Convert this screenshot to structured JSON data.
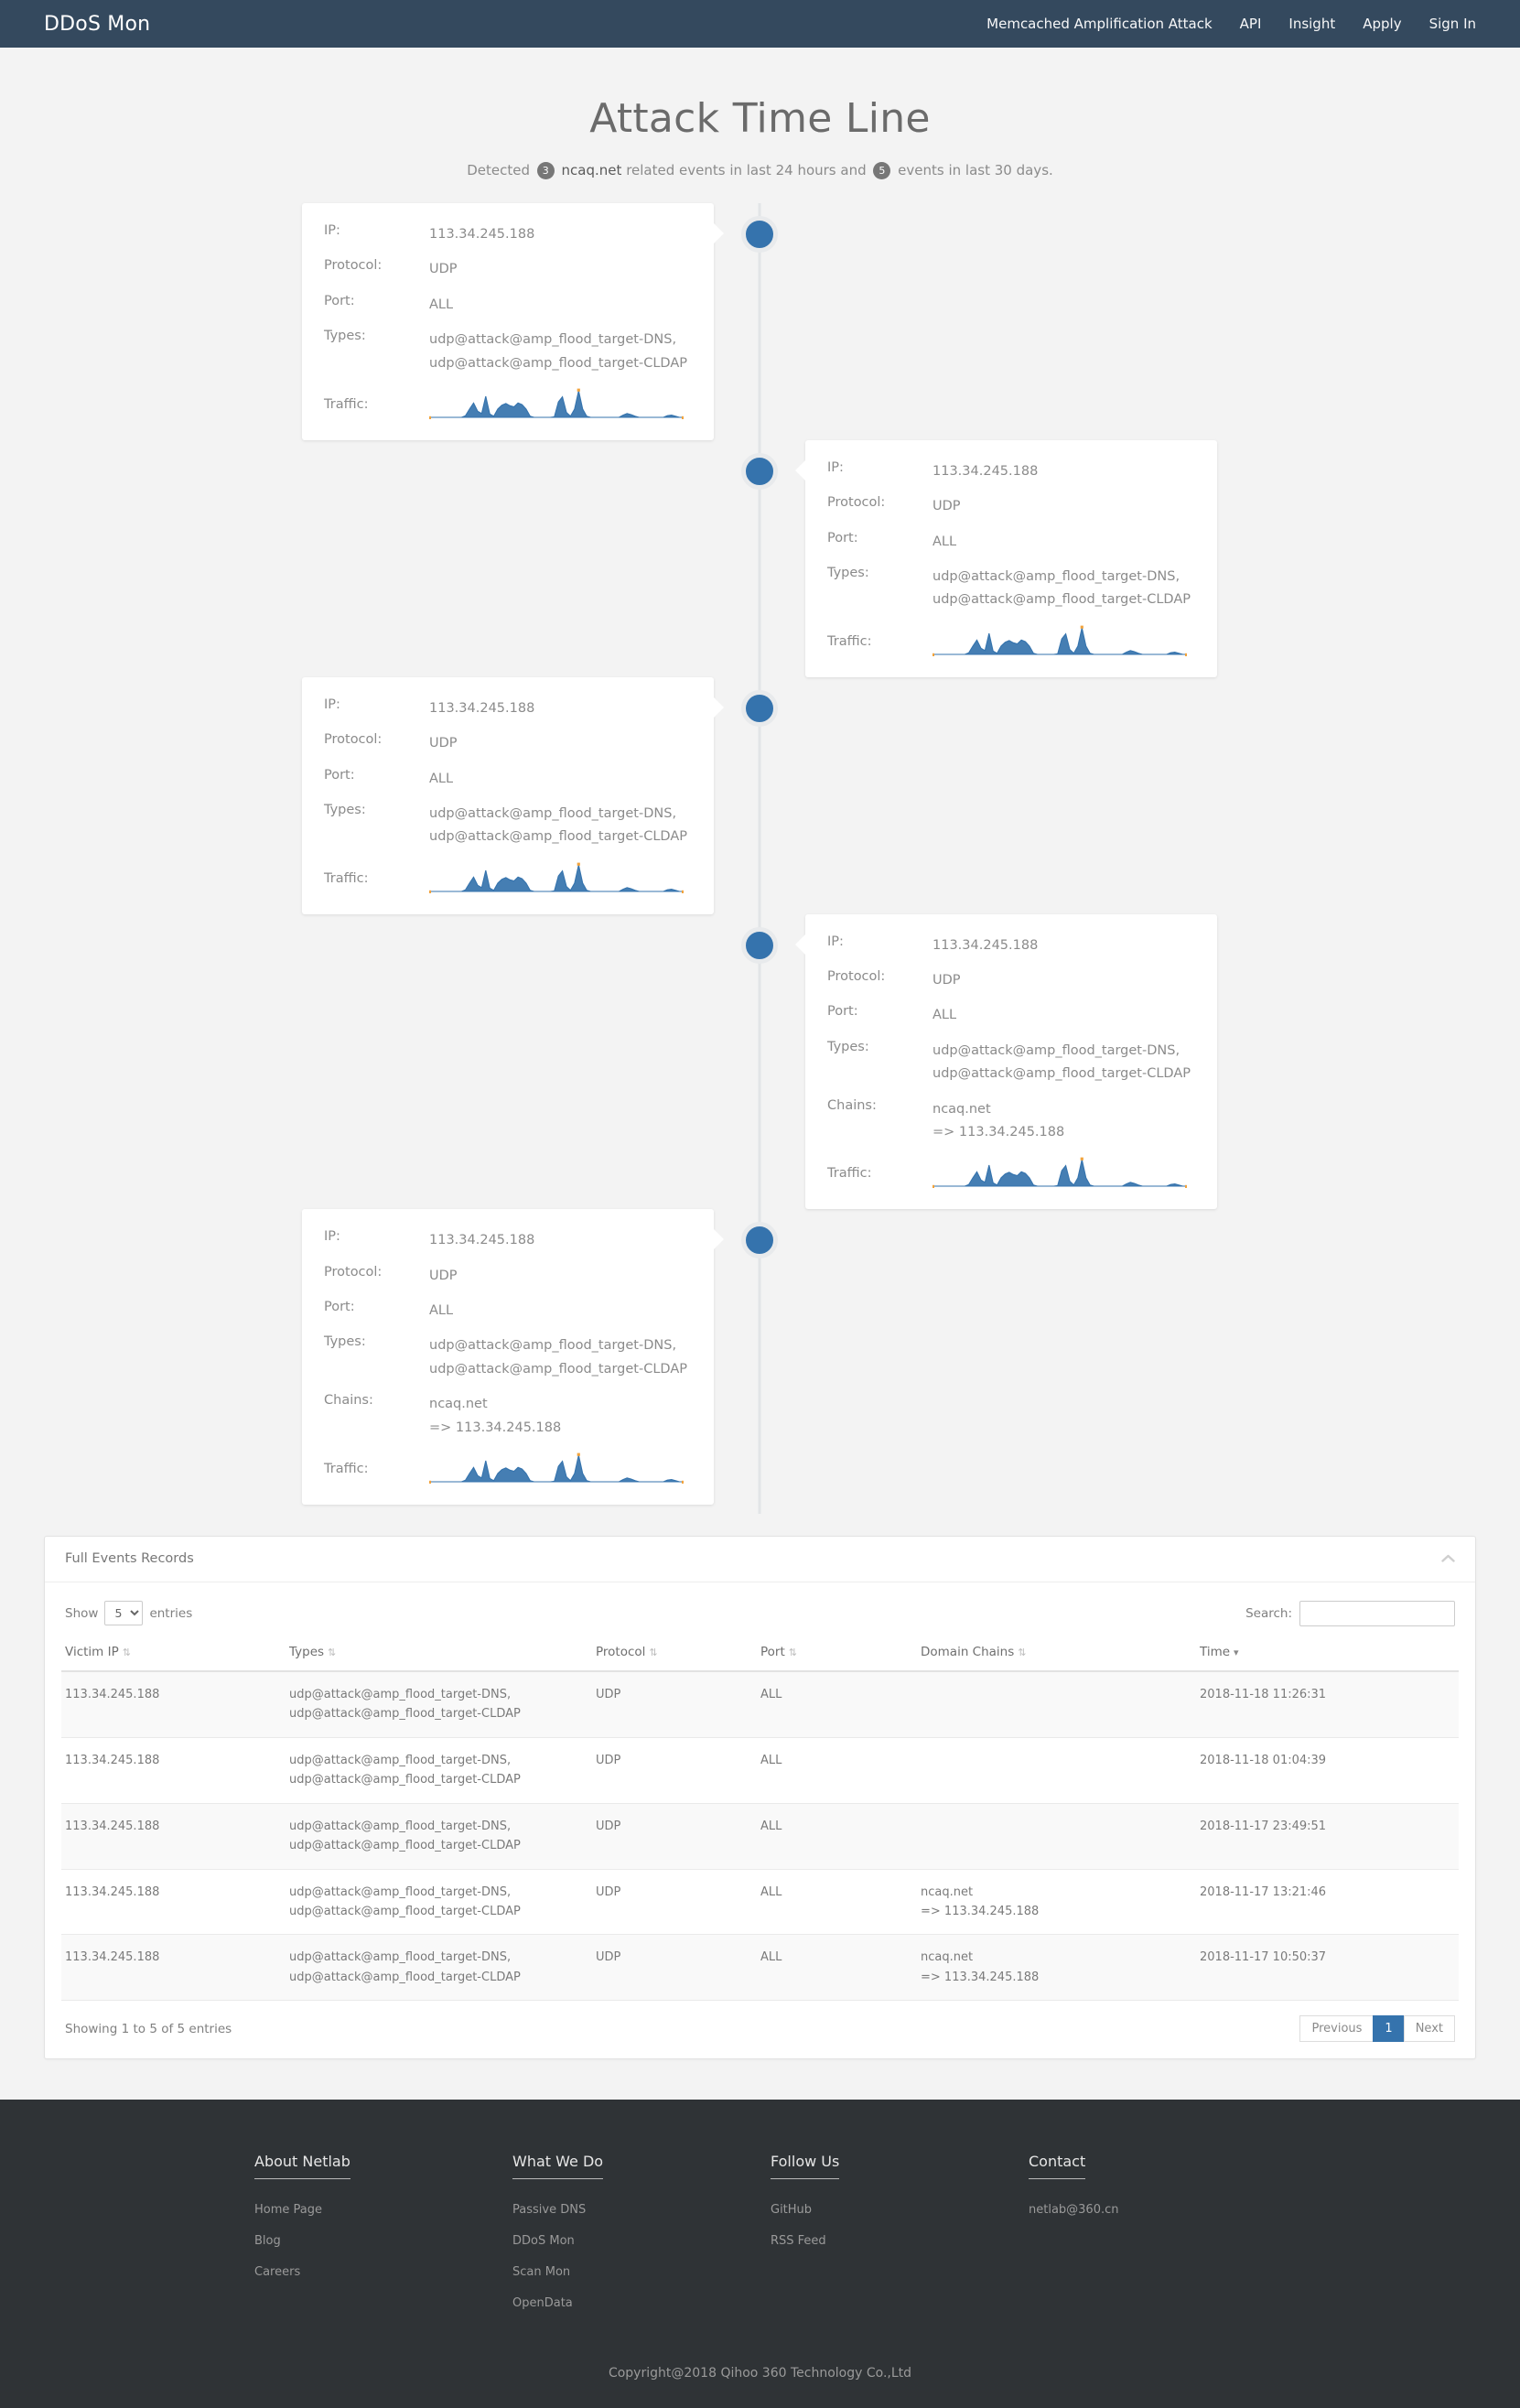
{
  "nav": {
    "brand": "DDoS Mon",
    "links": [
      {
        "label": "Memcached Amplification Attack"
      },
      {
        "label": "API"
      },
      {
        "label": "Insight"
      },
      {
        "label": "Apply"
      },
      {
        "label": "Sign In"
      }
    ]
  },
  "page": {
    "title": "Attack Time Line",
    "subtitle_part1": "Detected",
    "count_24h": "3",
    "domain": "ncaq.net",
    "subtitle_part2": "related events in last 24 hours and",
    "count_30d": "5",
    "subtitle_part3": "events in last 30 days."
  },
  "labels": {
    "ip": "IP:",
    "protocol": "Protocol:",
    "port": "Port:",
    "types": "Types:",
    "chains": "Chains:",
    "traffic": "Traffic:"
  },
  "timeline": {
    "events": [
      {
        "side": "left",
        "date": "2018-11-18",
        "time": "11:26:31",
        "ip": "113.34.245.188",
        "protocol": "UDP",
        "port": "ALL",
        "types_line1": "udp@attack@amp_flood_target-DNS,",
        "types_line2": "udp@attack@amp_flood_target-CLDAP",
        "chains_line1": "",
        "chains_line2": "",
        "has_chains": false
      },
      {
        "side": "right",
        "date": "2018-11-18",
        "time": "01:04:39",
        "ip": "113.34.245.188",
        "protocol": "UDP",
        "port": "ALL",
        "types_line1": "udp@attack@amp_flood_target-DNS,",
        "types_line2": "udp@attack@amp_flood_target-CLDAP",
        "chains_line1": "",
        "chains_line2": "",
        "has_chains": false
      },
      {
        "side": "left",
        "date": "2018-11-17",
        "time": "23:49:51",
        "ip": "113.34.245.188",
        "protocol": "UDP",
        "port": "ALL",
        "types_line1": "udp@attack@amp_flood_target-DNS,",
        "types_line2": "udp@attack@amp_flood_target-CLDAP",
        "chains_line1": "",
        "chains_line2": "",
        "has_chains": false
      },
      {
        "side": "right",
        "date": "2018-11-17",
        "time": "13:21:46",
        "ip": "113.34.245.188",
        "protocol": "UDP",
        "port": "ALL",
        "types_line1": "udp@attack@amp_flood_target-DNS,",
        "types_line2": "udp@attack@amp_flood_target-CLDAP",
        "chains_line1": "ncaq.net",
        "chains_line2": "=> 113.34.245.188",
        "has_chains": true
      },
      {
        "side": "left",
        "date": "2018-11-17",
        "time": "10:50:37",
        "ip": "113.34.245.188",
        "protocol": "UDP",
        "port": "ALL",
        "types_line1": "udp@attack@amp_flood_target-DNS,",
        "types_line2": "udp@attack@amp_flood_target-CLDAP",
        "chains_line1": "ncaq.net",
        "chains_line2": "=> 113.34.245.188",
        "has_chains": true
      }
    ]
  },
  "chart_data": {
    "type": "area",
    "title": "Traffic",
    "xlabel": "",
    "ylabel": "",
    "grid": false,
    "legend": "none",
    "line_color": "#3573ad",
    "fill_color": "#3573ad",
    "marker_color": "#f2a33c",
    "ylim": [
      0,
      100
    ],
    "series": [
      {
        "name": "Traffic sparkline",
        "values": [
          0,
          0,
          0,
          0,
          0,
          0,
          0,
          0,
          0,
          6,
          30,
          52,
          22,
          14,
          76,
          12,
          4,
          30,
          44,
          50,
          42,
          38,
          52,
          46,
          30,
          4,
          0,
          0,
          0,
          0,
          0,
          2,
          56,
          74,
          18,
          4,
          30,
          96,
          30,
          4,
          0,
          0,
          0,
          0,
          0,
          0,
          0,
          0,
          8,
          14,
          10,
          4,
          0,
          0,
          0,
          0,
          0,
          0,
          0,
          6,
          8,
          4,
          0,
          0
        ]
      }
    ]
  },
  "panel": {
    "title": "Full Events Records",
    "collapse_icon": "chevron-up",
    "show_label": "Show",
    "entries_label": "entries",
    "page_length": "5",
    "page_length_options": [
      "5",
      "10",
      "25",
      "50",
      "100"
    ],
    "search_label": "Search:",
    "search_value": "",
    "search_placeholder": "",
    "columns": [
      {
        "label": "Victim IP",
        "sort": "none"
      },
      {
        "label": "Types",
        "sort": "none"
      },
      {
        "label": "Protocol",
        "sort": "none"
      },
      {
        "label": "Port",
        "sort": "none"
      },
      {
        "label": "Domain Chains",
        "sort": "none"
      },
      {
        "label": "Time",
        "sort": "desc"
      }
    ],
    "rows": [
      {
        "victim_ip": "113.34.245.188",
        "types_line1": "udp@attack@amp_flood_target-DNS,",
        "types_line2": "udp@attack@amp_flood_target-CLDAP",
        "protocol": "UDP",
        "port": "ALL",
        "chains_line1": "",
        "chains_line2": "",
        "time": "2018-11-18 11:26:31"
      },
      {
        "victim_ip": "113.34.245.188",
        "types_line1": "udp@attack@amp_flood_target-DNS,",
        "types_line2": "udp@attack@amp_flood_target-CLDAP",
        "protocol": "UDP",
        "port": "ALL",
        "chains_line1": "",
        "chains_line2": "",
        "time": "2018-11-18 01:04:39"
      },
      {
        "victim_ip": "113.34.245.188",
        "types_line1": "udp@attack@amp_flood_target-DNS,",
        "types_line2": "udp@attack@amp_flood_target-CLDAP",
        "protocol": "UDP",
        "port": "ALL",
        "chains_line1": "",
        "chains_line2": "",
        "time": "2018-11-17 23:49:51"
      },
      {
        "victim_ip": "113.34.245.188",
        "types_line1": "udp@attack@amp_flood_target-DNS,",
        "types_line2": "udp@attack@amp_flood_target-CLDAP",
        "protocol": "UDP",
        "port": "ALL",
        "chains_line1": "ncaq.net",
        "chains_line2": "=> 113.34.245.188",
        "time": "2018-11-17 13:21:46"
      },
      {
        "victim_ip": "113.34.245.188",
        "types_line1": "udp@attack@amp_flood_target-DNS,",
        "types_line2": "udp@attack@amp_flood_target-CLDAP",
        "protocol": "UDP",
        "port": "ALL",
        "chains_line1": "ncaq.net",
        "chains_line2": "=> 113.34.245.188",
        "time": "2018-11-17 10:50:37"
      }
    ],
    "showing_info": "Showing 1 to 5 of 5 entries",
    "pager": {
      "previous": "Previous",
      "current": "1",
      "next": "Next"
    }
  },
  "footer": {
    "columns": [
      {
        "heading": "About Netlab",
        "links": [
          {
            "label": "Home Page"
          },
          {
            "label": "Blog"
          },
          {
            "label": "Careers"
          }
        ]
      },
      {
        "heading": "What We Do",
        "links": [
          {
            "label": "Passive DNS"
          },
          {
            "label": "DDoS Mon"
          },
          {
            "label": "Scan Mon"
          },
          {
            "label": "OpenData"
          }
        ]
      },
      {
        "heading": "Follow Us",
        "links": [
          {
            "label": "GitHub"
          },
          {
            "label": "RSS Feed"
          }
        ]
      },
      {
        "heading": "Contact",
        "links": [
          {
            "label": "netlab@360.cn"
          }
        ]
      }
    ],
    "copyright": "Copyright@2018 Qihoo 360 Technology Co.,Ltd"
  },
  "colors": {
    "navbar": "#34495e",
    "accent": "#3573ad",
    "page_bg": "#f3f3f3",
    "footer_bg": "#2f3336",
    "marker": "#f2a33c"
  }
}
